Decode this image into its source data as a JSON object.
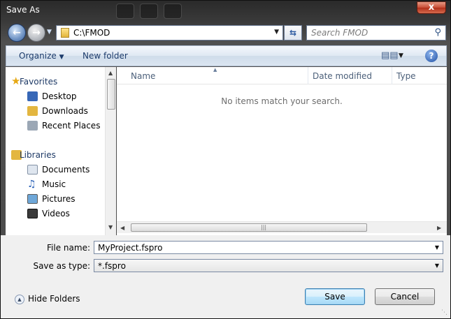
{
  "window": {
    "title": "Save As",
    "close_label": "x"
  },
  "address": {
    "path": "C:\\FMOD"
  },
  "search": {
    "placeholder": "Search FMOD"
  },
  "toolbar": {
    "organize_label": "Organize",
    "new_folder_label": "New folder",
    "help_label": "?"
  },
  "nav": {
    "groups": [
      {
        "label": "Favorites",
        "items": [
          "Desktop",
          "Downloads",
          "Recent Places"
        ]
      },
      {
        "label": "Libraries",
        "items": [
          "Documents",
          "Music",
          "Pictures",
          "Videos"
        ]
      }
    ]
  },
  "list": {
    "columns": [
      "Name",
      "Date modified",
      "Type"
    ],
    "empty_message": "No items match your search."
  },
  "form": {
    "file_name_label": "File name:",
    "file_name_value": "MyProject.fspro",
    "save_type_label": "Save as type:",
    "save_type_value": "*.fspro"
  },
  "footer": {
    "hide_folders_label": "Hide Folders",
    "save_label": "Save",
    "cancel_label": "Cancel"
  },
  "colors": {
    "accent": "#3c7fb1",
    "toolbar_text": "#1c3b6b"
  }
}
